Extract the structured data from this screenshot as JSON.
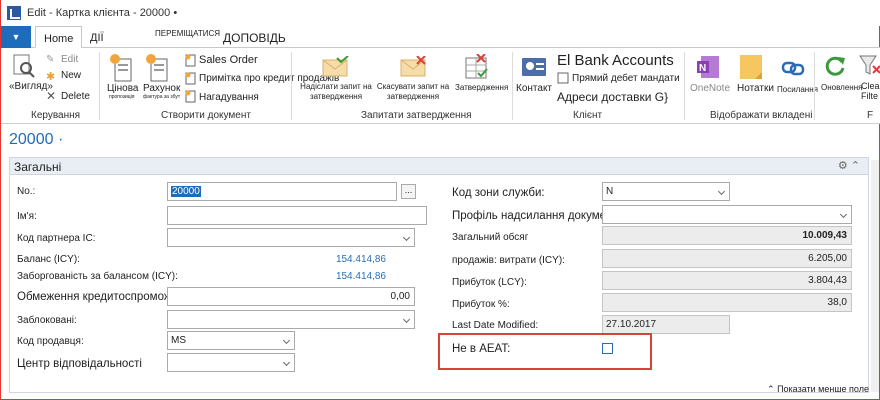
{
  "window": {
    "title": "Edit - Картка клієнта - 20000 •"
  },
  "tabs": {
    "file": "▼",
    "home": "Home",
    "actions": "ДІЇ",
    "navigate": "ПЕРЕМІЩАТИСЯ",
    "report": "ДОПОВІДЬ"
  },
  "ribbon": {
    "manage": {
      "view": "«Вигляд»",
      "edit": "Edit",
      "new": "New",
      "delete": "Delete",
      "group": "Керування"
    },
    "create": {
      "price": "Цінова",
      "invoice": "Рахунок",
      "price_sub": "пропозиція",
      "invoice_sub": "фактура за збут",
      "sales_order": "Sales Order",
      "credit_memo": "Примітка про кредит продажів",
      "reminder": "Нагадування",
      "group": "Створити документ"
    },
    "approval": {
      "send": "Надіслати запит на затвердження",
      "cancel": "Скасувати запит на затвердження",
      "approvals": "Затвердження",
      "group": "Запитати затвердження"
    },
    "customer": {
      "contact": "Контакт",
      "bank": "El Bank Accounts",
      "direct_debit": "Прямий дебет мандати",
      "ship_to": "Адреси доставки G}",
      "group": "Клієнт"
    },
    "show": {
      "onenote": "OneNote",
      "notes": "Нотатки",
      "links": "Посилання",
      "group": "Відображати вкладені"
    },
    "refresh": "Оновлення",
    "clear_filter": "Clea Filte",
    "page_group": "F"
  },
  "record": {
    "title": "20000 ·"
  },
  "general": {
    "title": "Загальні",
    "no_label": "No.:",
    "no_value": "20000",
    "name_label": "Ім'я:",
    "ic_label": "Код партнера IC:",
    "balance_label": "Баланс (ICY):",
    "balance_value": "154.414,86",
    "overdue_label": "Заборгованість за балансом (ICY):",
    "overdue_value": "154.414,86",
    "credit_label": "Обмеження кредитоспроможності",
    "credit_value": "0,00",
    "blocked_label": "Заблоковані:",
    "salesperson_label": "Код продавця:",
    "salesperson_value": "MS",
    "resp_label": "Центр відповідальності",
    "service_zone_label": "Код зони служби:",
    "service_zone_value": "N",
    "doc_profile_label": "Профіль надсилання документа:",
    "total_label": "Загальний обсяг",
    "total_value": "10.009,43",
    "costs_label": "продажів: витрати (ICY):",
    "costs_value": "6.205,00",
    "profit_label": "Прибуток (LCY):",
    "profit_value": "3.804,43",
    "profit_pct_label": "Прибуток %:",
    "profit_pct_value": "38,0",
    "modified_label": "Last Date Modified:",
    "modified_value": "27.10.2017",
    "aeat_label": "Не в AEAT:",
    "show_less": "Показати менше поле"
  },
  "colors": {
    "accent": "#1e6dbd",
    "highlight_border": "#d9413b"
  }
}
